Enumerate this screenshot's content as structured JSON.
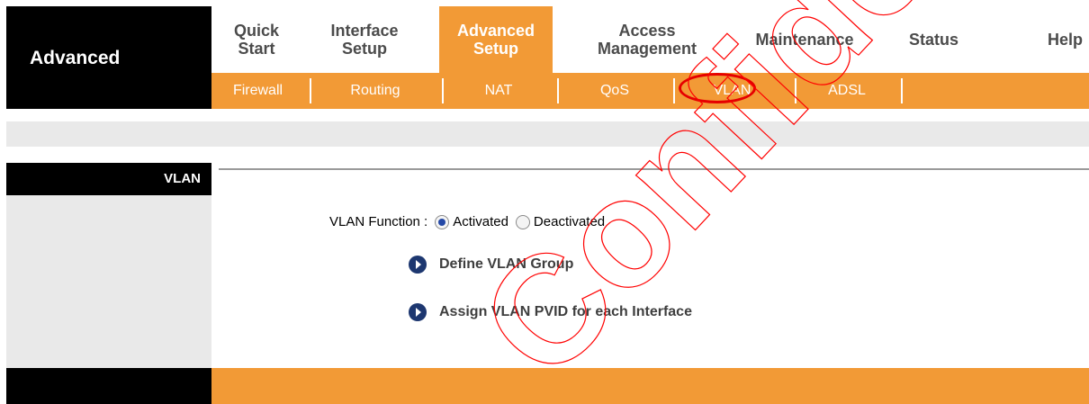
{
  "brand": "Advanced",
  "tabs": [
    {
      "label_line1": "Quick",
      "label_line2": "Start"
    },
    {
      "label_line1": "Interface",
      "label_line2": "Setup"
    },
    {
      "label_line1": "Advanced",
      "label_line2": "Setup"
    },
    {
      "label_line1": "Access",
      "label_line2": "Management"
    },
    {
      "label_line1": "Maintenance",
      "label_line2": ""
    },
    {
      "label_line1": "Status",
      "label_line2": ""
    },
    {
      "label_line1": "Help",
      "label_line2": ""
    }
  ],
  "subtabs": [
    "Firewall",
    "Routing",
    "NAT",
    "QoS",
    "VLAN",
    "ADSL"
  ],
  "section_title": "VLAN",
  "vlan": {
    "function_label": "VLAN Function :",
    "option_activated": "Activated",
    "option_deactivated": "Deactivated",
    "selected": "Activated"
  },
  "links": {
    "define_group": "Define VLAN Group",
    "assign_pvid": "Assign VLAN PVID for each Interface"
  },
  "watermark_text": "Confidential",
  "colors": {
    "accent_orange": "#f29a36",
    "highlight_red": "#e60000"
  }
}
